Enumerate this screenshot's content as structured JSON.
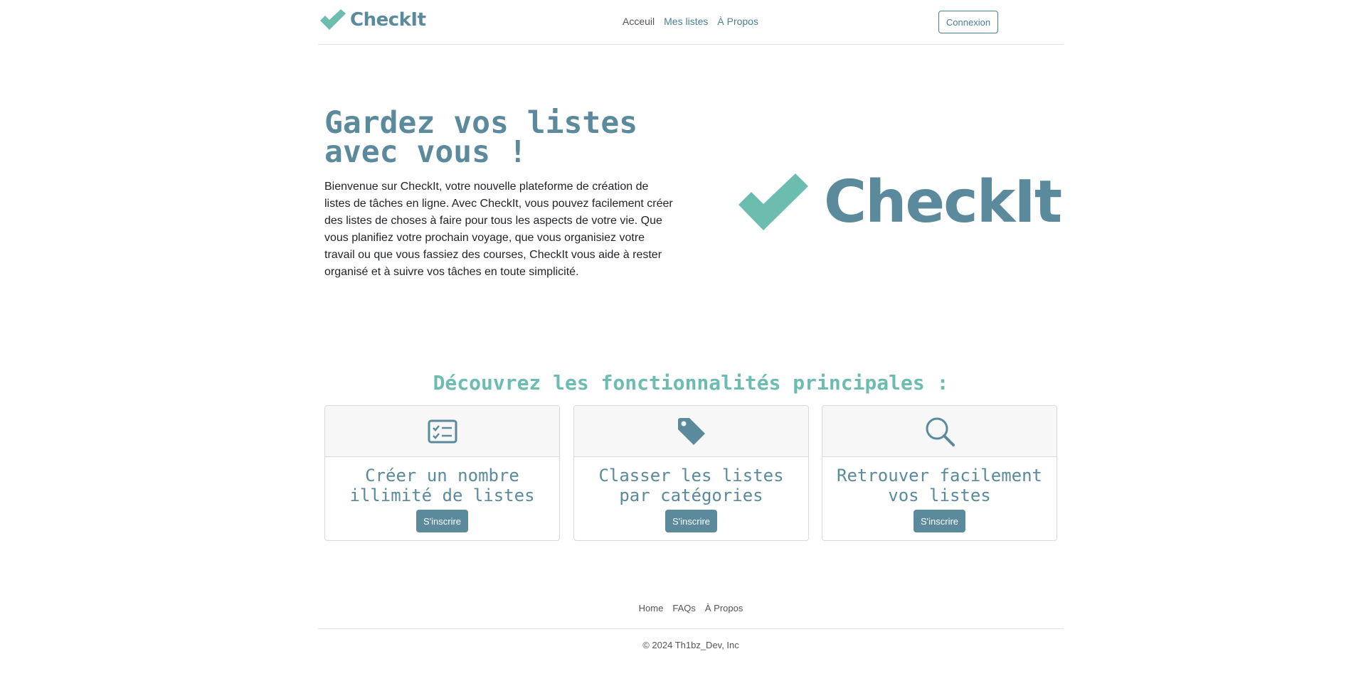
{
  "header": {
    "brand": "CheckIt",
    "nav": [
      "Acceuil",
      "Mes listes",
      "À Propos"
    ],
    "login_label": "Connexion"
  },
  "hero": {
    "title_line1": "Gardez vos listes",
    "title_line2": "avec vous !",
    "text": "Bienvenue sur CheckIt, votre nouvelle plateforme de création de listes de tâches en ligne. Avec CheckIt, vous pouvez facilement créer des listes de choses à faire pour tous les aspects de votre vie. Que vous planifiez votre prochain voyage, que vous organisiez votre travail ou que vous fassiez des courses, CheckIt vous aide à rester organisé et à suivre vos tâches en toute simplicité.",
    "logo_text": "CheckIt"
  },
  "features": {
    "title": "Découvrez les fonctionnalités principales :",
    "cards": [
      {
        "icon": "checklist-icon",
        "title": "Créer un nombre illimité de listes",
        "button": "S'inscrire"
      },
      {
        "icon": "tag-icon",
        "title": "Classer les listes par catégories",
        "button": "S'inscrire"
      },
      {
        "icon": "search-icon",
        "title": "Retrouver facilement vos listes",
        "button": "S'inscrire"
      }
    ]
  },
  "footer": {
    "links": [
      "Home",
      "FAQs",
      "À Propos"
    ],
    "copyright": "© 2024 Th1bz_Dev, Inc"
  },
  "colors": {
    "brand": "#5a8a9c",
    "accent": "#6cbcb0"
  }
}
